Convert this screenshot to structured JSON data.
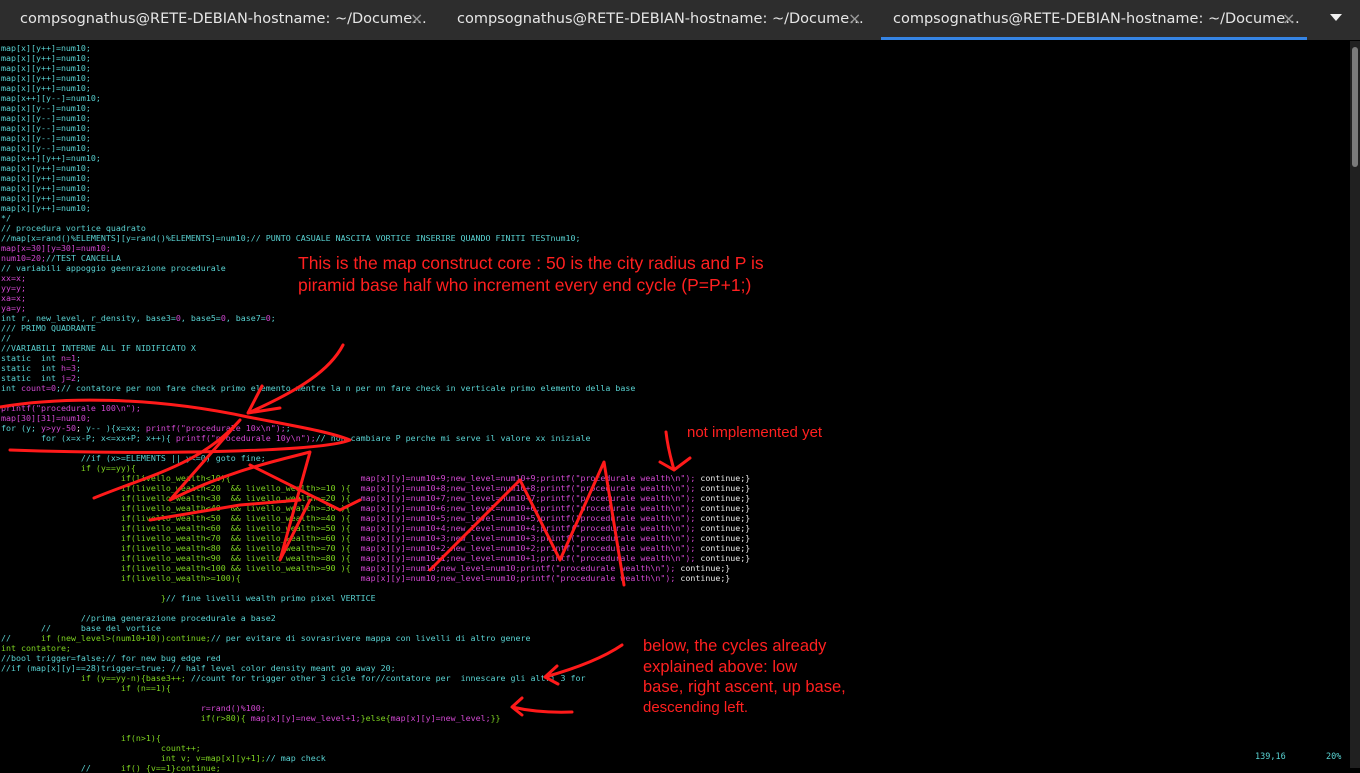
{
  "tabs": [
    {
      "title": "compsognathus@RETE-DEBIAN-hostname: ~/Docume…",
      "close": "×"
    },
    {
      "title": "compsognathus@RETE-DEBIAN-hostname: ~/Docume…",
      "close": "×"
    },
    {
      "title": "compsognathus@RETE-DEBIAN-hostname: ~/Docume…",
      "close": "×"
    }
  ],
  "status": {
    "position": "139,16",
    "percent": "20%"
  },
  "annotations": {
    "a1_line1": "This is the map construct core : 50 is the city radius and P is",
    "a1_line2": "piramid base half who increment every end cycle (P=P+1;)",
    "a2": "not implemented yet",
    "a3_line1": "below, the cycles already",
    "a3_line2": "explained above:  low",
    "a3_line3": "base, right ascent, up base,",
    "a3_line4": "descending left."
  },
  "colors": {
    "annotation": "#ff2020",
    "code_cyan": "#59d2d2",
    "code_green": "#7ed321",
    "code_magenta": "#d148d1"
  },
  "code": [
    [
      [
        "c",
        "map[x][y++]=num10;"
      ]
    ],
    [
      [
        "c",
        "map[x][y++]=num10;"
      ]
    ],
    [
      [
        "c",
        "map[x][y++]=num10;"
      ]
    ],
    [
      [
        "c",
        "map[x][y++]=num10;"
      ]
    ],
    [
      [
        "c",
        "map[x][y++]=num10;"
      ]
    ],
    [
      [
        "c",
        "map[x++][y--]=num10;"
      ]
    ],
    [
      [
        "c",
        "map[x][y--]=num10;"
      ]
    ],
    [
      [
        "c",
        "map[x][y--]=num10;"
      ]
    ],
    [
      [
        "c",
        "map[x][y--]=num10;"
      ]
    ],
    [
      [
        "c",
        "map[x][y--]=num10;"
      ]
    ],
    [
      [
        "c",
        "map[x][y--]=num10;"
      ]
    ],
    [
      [
        "c",
        "map[x++][y++]=num10;"
      ]
    ],
    [
      [
        "c",
        "map[x][y++]=num10;"
      ]
    ],
    [
      [
        "c",
        "map[x][y++]=num10;"
      ]
    ],
    [
      [
        "c",
        "map[x][y++]=num10;"
      ]
    ],
    [
      [
        "c",
        "map[x][y++]=num10;"
      ]
    ],
    [
      [
        "c",
        "map[x][y++]=num10;"
      ]
    ],
    [
      [
        "c",
        "*/"
      ]
    ],
    [
      [
        "c",
        "// procedura vortice quadrato"
      ]
    ],
    [
      [
        "c",
        "//map[x=rand()%ELEMENTS][y=rand()%ELEMENTS]=num10;// PUNTO CASUALE NASCITA VORTICE INSERIRE QUANDO FINITI TESTnum10;"
      ]
    ],
    [
      [
        "m",
        "map[x=30][y=30]=num10;"
      ]
    ],
    [
      [
        "m",
        "num10=20;"
      ],
      [
        "c",
        "//TEST CANCELLA"
      ]
    ],
    [
      [
        "c",
        "// variabili appoggio geenrazione procedurale"
      ]
    ],
    [
      [
        "m",
        "xx=x;"
      ]
    ],
    [
      [
        "m",
        "yy=y;"
      ]
    ],
    [
      [
        "m",
        "xa=x;"
      ]
    ],
    [
      [
        "m",
        "ya=y;"
      ]
    ],
    [
      [
        "c",
        "int r, new_level, r_density, base3="
      ],
      [
        "m",
        "0"
      ],
      [
        "c",
        ", base5="
      ],
      [
        "m",
        "0"
      ],
      [
        "c",
        ", base7="
      ],
      [
        "m",
        "0"
      ],
      [
        "c",
        ";"
      ]
    ],
    [
      [
        "c",
        "/// PRIMO QUADRANTE"
      ]
    ],
    [
      [
        "c",
        "//"
      ]
    ],
    [
      [
        "c",
        "//VARIABILI INTERNE ALL IF NIDIFICATO X"
      ]
    ],
    [
      [
        "c",
        "static  int "
      ],
      [
        "m",
        "n=1"
      ],
      [
        "c",
        ";"
      ]
    ],
    [
      [
        "c",
        "static  int "
      ],
      [
        "m",
        "h=3"
      ],
      [
        "c",
        ";"
      ]
    ],
    [
      [
        "c",
        "static  int "
      ],
      [
        "m",
        "j=2"
      ],
      [
        "c",
        ";"
      ]
    ],
    [
      [
        "c",
        "int "
      ],
      [
        "m",
        "count=0"
      ],
      [
        "c",
        ";// contatore per non fare check primo elemento mentre la n per nn fare check in verticale primo elemento della base"
      ]
    ],
    [
      [
        "c",
        ""
      ]
    ],
    [
      [
        "m",
        "printf(\"procedurale 100\\n\");"
      ]
    ],
    [
      [
        "m",
        "map[30][31]=num10;"
      ]
    ],
    [
      [
        "c",
        "for (y; "
      ],
      [
        "m",
        "y>yy-50"
      ],
      [
        "w",
        "; "
      ],
      [
        "c",
        "y-- ){x=xx; "
      ],
      [
        "m",
        "printf(\"procedurale 10x\\n\");"
      ],
      [
        "c",
        ";"
      ]
    ],
    [
      [
        "c",
        "        for (x=x-P; x<=xx+P; x++){ "
      ],
      [
        "m",
        "printf(\"procedurale 10y\\n\");"
      ],
      [
        "c",
        "// non cambiare P perche mi serve il valore xx iniziale"
      ]
    ],
    [
      [
        "c",
        ""
      ]
    ],
    [
      [
        "c",
        "                //if (x>=ELEMENTS || y<=0) goto fine;"
      ]
    ],
    [
      [
        "g",
        "                if (y==yy){"
      ]
    ],
    [
      [
        "g",
        "                        if(livello_wealth<10){                          "
      ],
      [
        "m",
        "map[x][y]=num10+9;new_level=num10+9;printf(\"procedurale wealth\\n\");"
      ],
      [
        "w",
        " continue;}"
      ]
    ],
    [
      [
        "g",
        "                        if(livello_wealth<20  && livello_wealth>=10 ){  "
      ],
      [
        "m",
        "map[x][y]=num10+8;new_level=num10+8;printf(\"procedurale wealth\\n\");"
      ],
      [
        "w",
        " continue;}"
      ]
    ],
    [
      [
        "g",
        "                        if(livello_wealth<30  && livello_wealth>=20 ){  "
      ],
      [
        "m",
        "map[x][y]=num10+7;new_level=num10+7;printf(\"procedurale wealth\\n\");"
      ],
      [
        "w",
        " continue;}"
      ]
    ],
    [
      [
        "g",
        "                        if(livello_wealth<40  && livello_wealth>=30 ){  "
      ],
      [
        "m",
        "map[x][y]=num10+6;new_level=num10+6;printf(\"procedurale wealth\\n\");"
      ],
      [
        "w",
        " continue;}"
      ]
    ],
    [
      [
        "g",
        "                        if(livello_wealth<50  && livello_wealth>=40 ){  "
      ],
      [
        "m",
        "map[x][y]=num10+5;new_level=num10+5;printf(\"procedurale wealth\\n\");"
      ],
      [
        "w",
        " continue;}"
      ]
    ],
    [
      [
        "g",
        "                        if(livello_wealth<60  && livello_wealth>=50 ){  "
      ],
      [
        "m",
        "map[x][y]=num10+4;new_level=num10+4;printf(\"procedurale wealth\\n\");"
      ],
      [
        "w",
        " continue;}"
      ]
    ],
    [
      [
        "g",
        "                        if(livello_wealth<70  && livello_wealth>=60 ){  "
      ],
      [
        "m",
        "map[x][y]=num10+3;new_level=num10+3;printf(\"procedurale wealth\\n\");"
      ],
      [
        "w",
        " continue;}"
      ]
    ],
    [
      [
        "g",
        "                        if(livello_wealth<80  && livello_wealth>=70 ){  "
      ],
      [
        "m",
        "map[x][y]=num10+2;new_level=num10+2;printf(\"procedurale wealth\\n\");"
      ],
      [
        "w",
        " continue;}"
      ]
    ],
    [
      [
        "g",
        "                        if(livello_wealth<90  && livello_wealth>=80 ){  "
      ],
      [
        "m",
        "map[x][y]=num10+1;new_level=num10+1;printf(\"procedurale wealth\\n\");"
      ],
      [
        "w",
        " continue;}"
      ]
    ],
    [
      [
        "g",
        "                        if(livello_wealth<100 && livello_wealth>=90 ){  "
      ],
      [
        "m",
        "map[x][y]=num10;new_level=num10;printf(\"procedurale wealth\\n\");"
      ],
      [
        "w",
        " continue;}"
      ]
    ],
    [
      [
        "g",
        "                        if(livello_wealth>=100){                        "
      ],
      [
        "m",
        "map[x][y]=num10;new_level=num10;printf(\"procedurale wealth\\n\");"
      ],
      [
        "w",
        " continue;}"
      ]
    ],
    [
      [
        "c",
        ""
      ]
    ],
    [
      [
        "g",
        "                                }"
      ],
      [
        "c",
        "// fine livelli wealth primo pixel VERTICE"
      ]
    ],
    [
      [
        "c",
        ""
      ]
    ],
    [
      [
        "c",
        "                //prima generazione procedurale a base2"
      ]
    ],
    [
      [
        "c",
        "        //      base del vortice"
      ]
    ],
    [
      [
        "c",
        "//      "
      ],
      [
        "g",
        "if (new_level>(num10+10))continue;"
      ],
      [
        "c",
        "// per evitare di sovrasrivere mappa con livelli di altro genere"
      ]
    ],
    [
      [
        "g",
        "int contatore;"
      ]
    ],
    [
      [
        "c",
        "//bool trigger=false;// for new bug edge red"
      ]
    ],
    [
      [
        "c",
        "//if (map[x][y]==28)trigger=true; // half level color density meant go away 20;"
      ]
    ],
    [
      [
        "g",
        "                if (y==yy-n){base3++; "
      ],
      [
        "c",
        "//count for trigger other 3 cicle for//contatore per  innescare gli altri 3 for"
      ]
    ],
    [
      [
        "g",
        "                        if (n==1){"
      ]
    ],
    [
      [
        "c",
        ""
      ]
    ],
    [
      [
        "g",
        "                                        "
      ],
      [
        "m",
        "r=rand()%100;"
      ]
    ],
    [
      [
        "g",
        "                                        if(r>80){ "
      ],
      [
        "m",
        "map[x][y]=new_level+1;"
      ],
      [
        "g",
        "}else{"
      ],
      [
        "m",
        "map[x][y]=new_level;"
      ],
      [
        "g",
        "}}"
      ]
    ],
    [
      [
        "c",
        ""
      ]
    ],
    [
      [
        "g",
        "                        if(n>1){"
      ]
    ],
    [
      [
        "g",
        "                                count++;"
      ]
    ],
    [
      [
        "g",
        "                                int v; v=map[x][y+1];"
      ],
      [
        "c",
        "// map check"
      ]
    ],
    [
      [
        "c",
        "                //      "
      ],
      [
        "g",
        "if() {v==1}continue;"
      ]
    ]
  ]
}
